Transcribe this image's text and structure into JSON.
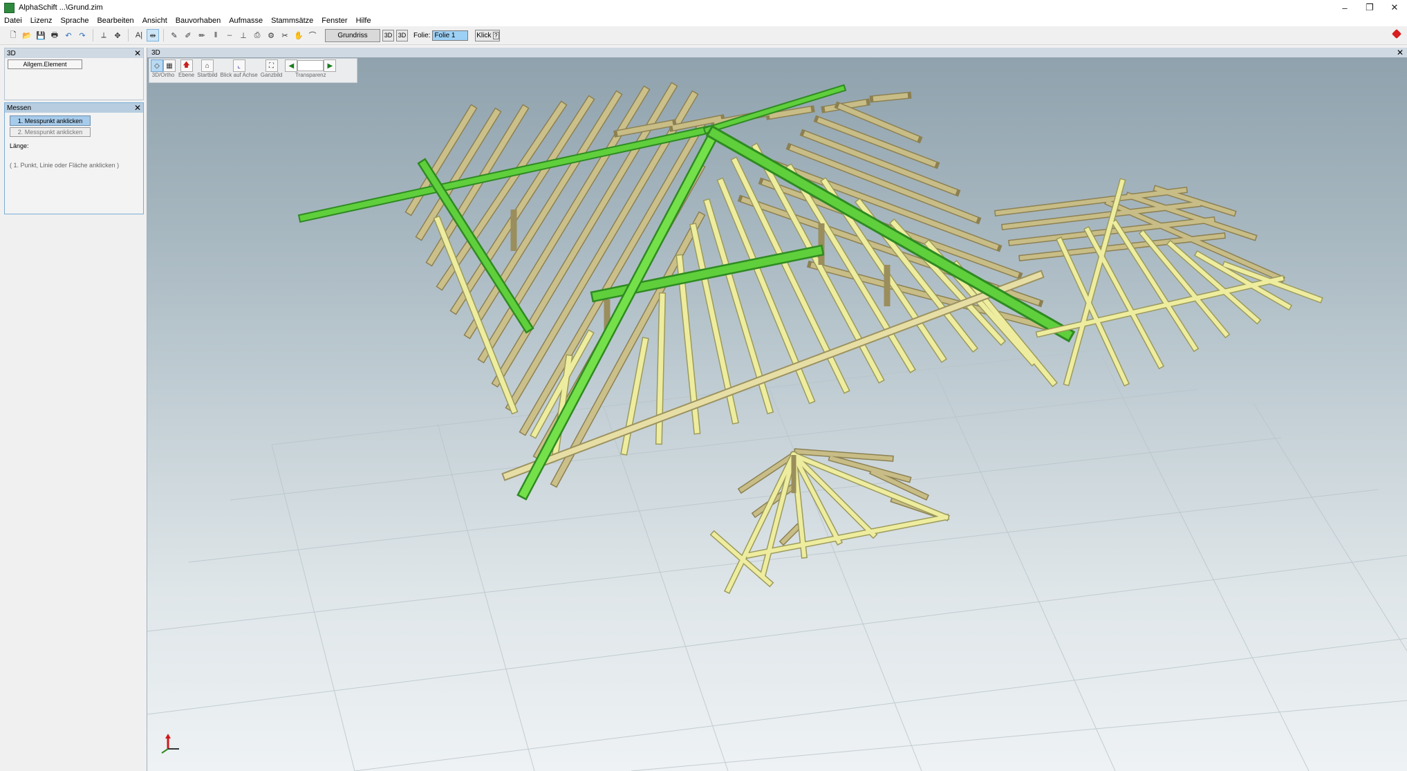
{
  "window": {
    "title": "AlphaSchift ...\\Grund.zim",
    "controls": {
      "minimize": "–",
      "restore": "❐",
      "close": "✕"
    }
  },
  "menu": [
    "Datei",
    "Lizenz",
    "Sprache",
    "Bearbeiten",
    "Ansicht",
    "Bauvorhaben",
    "Aufmasse",
    "Stammsätze",
    "Fenster",
    "Hilfe"
  ],
  "toolbar": {
    "grundriss_label": "Grundriss",
    "btn_3d_a": "3D",
    "btn_3d_b": "3D",
    "folie_label": "Folie:",
    "folie_value": "Folie 1",
    "klick_label": "Klick",
    "text_tool": "A|"
  },
  "panel_3d": {
    "title": "3D",
    "button": "Allgem.Element"
  },
  "panel_messen": {
    "title": "Messen",
    "btn1": "1. Messpunkt anklicken",
    "btn2": "2. Messpunkt anklicken",
    "length_label": "Länge:",
    "hint": "( 1. Punkt, Linie oder Fläche anklicken )"
  },
  "view": {
    "title": "3D",
    "toolbar": [
      {
        "label": "3D/Ortho"
      },
      {
        "label": "Ebene"
      },
      {
        "label": "Startbild"
      },
      {
        "label": "Blick auf Achse"
      },
      {
        "label": "Ganzbild"
      },
      {
        "label": "Transparenz"
      }
    ]
  },
  "colors": {
    "beam_green": "#5fcf3c",
    "beam_green_dark": "#2f8a22",
    "rafter_tan": "#c8bd86",
    "rafter_light": "#eeec9e",
    "rafter_dark": "#8c8052"
  }
}
